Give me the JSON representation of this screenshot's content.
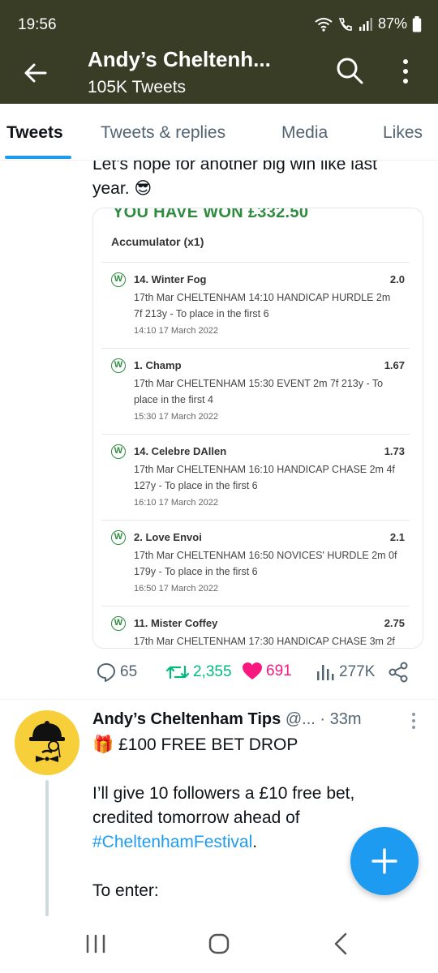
{
  "status_bar": {
    "time": "19:56",
    "battery": "87%"
  },
  "header": {
    "title": "Andy’s Cheltenh...",
    "subtitle": "105K Tweets"
  },
  "tabs": [
    {
      "label": "Tweets"
    },
    {
      "label": "Tweets & replies"
    },
    {
      "label": "Media"
    },
    {
      "label": "Likes"
    }
  ],
  "tweet1": {
    "text_line1": "Let’s hope for another big win like last",
    "text_line2": "year. 😎",
    "bet_slip": {
      "headline": "YOU HAVE WON £332.50",
      "bet_type": "Accumulator (x1)",
      "legs": [
        {
          "badge": "W",
          "name": "14. Winter Fog",
          "odds": "2.0",
          "desc": "17th Mar CHELTENHAM 14:10 HANDICAP HURDLE 2m 7f 213y - To place in the first 6",
          "time": "14:10 17 March 2022"
        },
        {
          "badge": "W",
          "name": "1. Champ",
          "odds": "1.67",
          "desc": "17th Mar CHELTENHAM 15:30 EVENT 2m 7f 213y - To place in the first 4",
          "time": "15:30 17 March 2022"
        },
        {
          "badge": "W",
          "name": "14. Celebre DAllen",
          "odds": "1.73",
          "desc": "17th Mar CHELTENHAM 16:10 HANDICAP CHASE 2m 4f 127y - To place in the first 6",
          "time": "16:10 17 March 2022"
        },
        {
          "badge": "W",
          "name": "2. Love Envoi",
          "odds": "2.1",
          "desc": "17th Mar CHELTENHAM 16:50 NOVICES' HURDLE 2m 0f 179y - To place in the first 6",
          "time": "16:50 17 March 2022"
        },
        {
          "badge": "W",
          "name": "11. Mister Coffey",
          "odds": "2.75",
          "desc": "17th Mar CHELTENHAM 17:30 HANDICAP CHASE 3m 2f",
          "time": ""
        }
      ]
    },
    "actions": {
      "replies": "65",
      "retweets": "2,355",
      "likes": "691",
      "views": "277K"
    }
  },
  "tweet2": {
    "name": "Andy’s Cheltenham Tips",
    "handle": "@...",
    "time": "· 33m",
    "line1_emoji": "🎁",
    "line1": "£100 FREE BET DROP",
    "line2": "I’ll give 10 followers a £10 free bet,",
    "line3": "credited tomorrow ahead of",
    "hashtag": "#CheltenhamFestival",
    "after_hashtag": ".",
    "line4": "To enter:"
  },
  "colors": {
    "header_bg": "#3a3d26",
    "accent": "#1d9bf0",
    "retweet": "#00ba7c",
    "like": "#f91880",
    "win_green": "#2e8b3e"
  }
}
